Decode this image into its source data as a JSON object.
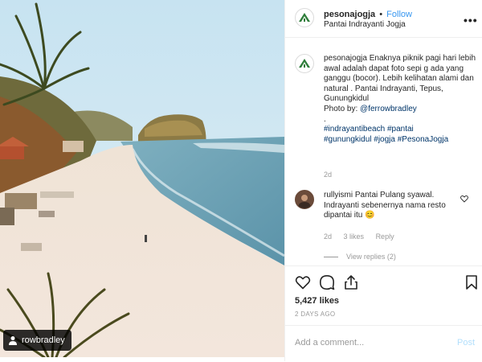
{
  "post": {
    "photo_alt": "Pantai Indrayanti beach",
    "tagged_user": "rowbradley"
  },
  "header": {
    "username": "pesonajogja",
    "separator": "•",
    "follow_label": "Follow",
    "location": "Pantai Indrayanti Jogja",
    "more_icon": "more-icon"
  },
  "caption": {
    "username": "pesonajogja",
    "text": "Enaknya piknik pagi hari lebih awal adalah dapat foto sepi g ada yang ganggu (bocor). Lebih kelihatan alami dan natural . Pantai Indrayanti, Tepus, Gunungkidul",
    "photo_by": "Photo by:",
    "credit": "@ferrowbradley",
    "dot": ".",
    "hashtags1": "#indrayantibeach #pantai",
    "hashtags2": "#gunungkidul #jogja #PesonaJogja",
    "time": "2d"
  },
  "comment": {
    "username": "rullyismi",
    "text": "Pantai Pulang syawal. Indrayanti sebenernya nama resto dipantai itu 😊",
    "time": "2d",
    "likes": "3 likes",
    "reply_label": "Reply",
    "view_replies": "View replies (2)"
  },
  "actions": {
    "likes": "5,427 likes",
    "ago": "2 DAYS AGO"
  },
  "comment_box": {
    "placeholder": "Add a comment...",
    "post_label": "Post"
  },
  "colors": {
    "link": "#3897f0",
    "brand": "#2e7d3a"
  }
}
